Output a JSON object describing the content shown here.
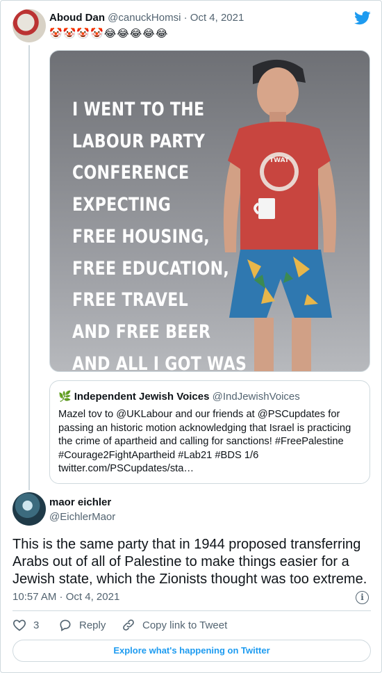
{
  "parent_tweet": {
    "name": "Aboud Dan",
    "handle": "@canuckHomsi",
    "separator": " · ",
    "date": "Oct 4, 2021",
    "emojis": "🤡🤡🤡🤡😂😂😂😂😂",
    "image_text": [
      "I WENT TO THE",
      "LABOUR PARTY",
      "CONFERENCE",
      "EXPECTING",
      "FREE HOUSING,",
      "FREE EDUCATION,",
      "FREE TRAVEL",
      "AND FREE BEER",
      "AND ALL I GOT WAS"
    ],
    "shirt_text": "TWAT"
  },
  "quoted_tweet": {
    "icon": "🌿",
    "name": "Independent Jewish Voices",
    "handle": "@IndJewishVoices",
    "lines": [
      "Mazel tov to @UKLabour and our friends at @PSCupdates for",
      "passing an historic motion acknowledging that Israel is practicing",
      "the crime of apartheid and calling for sanctions! #FreePalestine",
      "#Courage2FightApartheid #Lab21 #BDS 1/6",
      "twitter.com/PSCupdates/sta…"
    ]
  },
  "reply": {
    "name": "maor eichler",
    "handle": "@EichlerMaor",
    "lines": [
      "This is the same party that in 1944 proposed transferring",
      "Arabs out of all of Palestine to make things easier for a",
      "Jewish state, which the Zionists thought was too extreme."
    ],
    "time": "10:57 AM",
    "separator": " · ",
    "date": "Oct 4, 2021",
    "info_glyph": "i"
  },
  "actions": {
    "like_count": "3",
    "reply_label": "Reply",
    "copy_label": "Copy link to Tweet"
  },
  "footer": {
    "explore_label": "Explore what's happening on Twitter"
  },
  "colors": {
    "accent": "#1d9bf0",
    "secondary_text": "#536471",
    "border": "#cfd9de"
  },
  "icons": [
    "twitter-bird-icon",
    "info-icon",
    "heart-icon",
    "reply-icon",
    "link-icon",
    "leaf-icon"
  ]
}
